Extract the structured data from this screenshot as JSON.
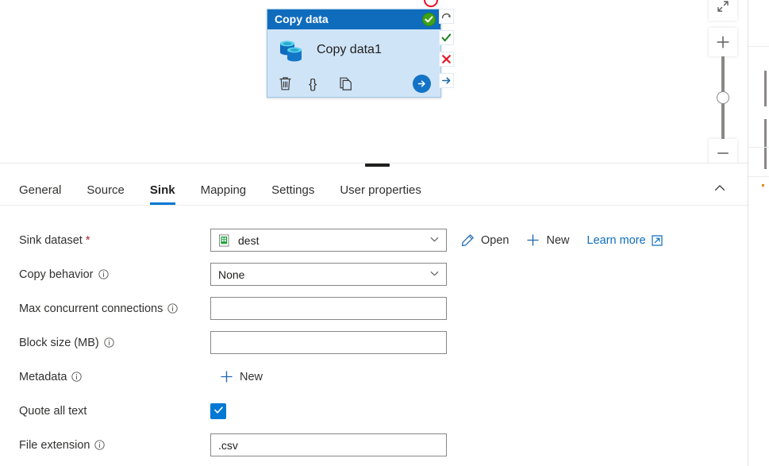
{
  "canvas": {
    "node": {
      "header_title": "Copy data",
      "status_icon": "green-check-circle-icon",
      "activity_icon": "copy-data-database-icon",
      "activity_name": "Copy data1",
      "actions": [
        {
          "name": "delete-activity",
          "icon": "trash-icon",
          "label": ""
        },
        {
          "name": "code-view-activity",
          "icon": "braces-icon",
          "label": "{}"
        },
        {
          "name": "clone-activity",
          "icon": "copy-icon",
          "label": ""
        }
      ],
      "next_button_icon": "arrow-right-circle-icon"
    },
    "handles": [
      {
        "name": "dependency-retry",
        "icon": "retry-arrow-icon"
      },
      {
        "name": "dependency-success",
        "icon": "green-check-icon"
      },
      {
        "name": "dependency-failure",
        "icon": "red-x-icon"
      },
      {
        "name": "dependency-completion",
        "icon": "blue-arrow-icon"
      }
    ],
    "skipped_handle": {
      "name": "dependency-skipped",
      "icon": "red-circle-icon"
    },
    "zoom_controls": {
      "fit_icon": "fit-to-screen-icon",
      "zoom_in_icon": "plus-icon",
      "zoom_out_icon": "minus-icon",
      "slider_name": "zoom-slider"
    }
  },
  "panel": {
    "drag_handle": "panel-resize-handle",
    "collapse_icon": "chevron-up-icon",
    "tabs": [
      {
        "label": "General",
        "active": false
      },
      {
        "label": "Source",
        "active": false
      },
      {
        "label": "Sink",
        "active": true
      },
      {
        "label": "Mapping",
        "active": false
      },
      {
        "label": "Settings",
        "active": false
      },
      {
        "label": "User properties",
        "active": false
      }
    ],
    "active_tab": "Sink",
    "form": {
      "sink_dataset": {
        "label": "Sink dataset",
        "required_mark": "*",
        "value": "dest",
        "dataset_icon": "dataset-file-icon",
        "chevron_icon": "chevron-down-icon",
        "open_label": "Open",
        "open_icon": "pencil-icon",
        "new_label": "New",
        "new_icon": "plus-icon",
        "learn_more_label": "Learn more",
        "learn_more_icon": "external-link-icon"
      },
      "copy_behavior": {
        "label": "Copy behavior",
        "info_icon": "info-icon",
        "value": "None",
        "chevron_icon": "chevron-down-icon"
      },
      "max_concurrent_connections": {
        "label": "Max concurrent connections",
        "info_icon": "info-icon",
        "value": "",
        "placeholder": ""
      },
      "block_size": {
        "label": "Block size (MB)",
        "info_icon": "info-icon",
        "value": "",
        "placeholder": ""
      },
      "metadata": {
        "label": "Metadata",
        "info_icon": "info-icon",
        "new_label": "New",
        "new_icon": "plus-icon"
      },
      "quote_all_text": {
        "label": "Quote all text",
        "checked": true,
        "check_icon": "checkmark-icon"
      },
      "file_extension": {
        "label": "File extension",
        "info_icon": "info-icon",
        "value": ".csv",
        "placeholder": ""
      }
    }
  },
  "colors": {
    "accent": "#0078d4",
    "node_header": "#0f6cbd",
    "node_body": "#cfe4f7",
    "success": "#3fa315",
    "error": "#e81123",
    "link": "#0f6cbd"
  }
}
